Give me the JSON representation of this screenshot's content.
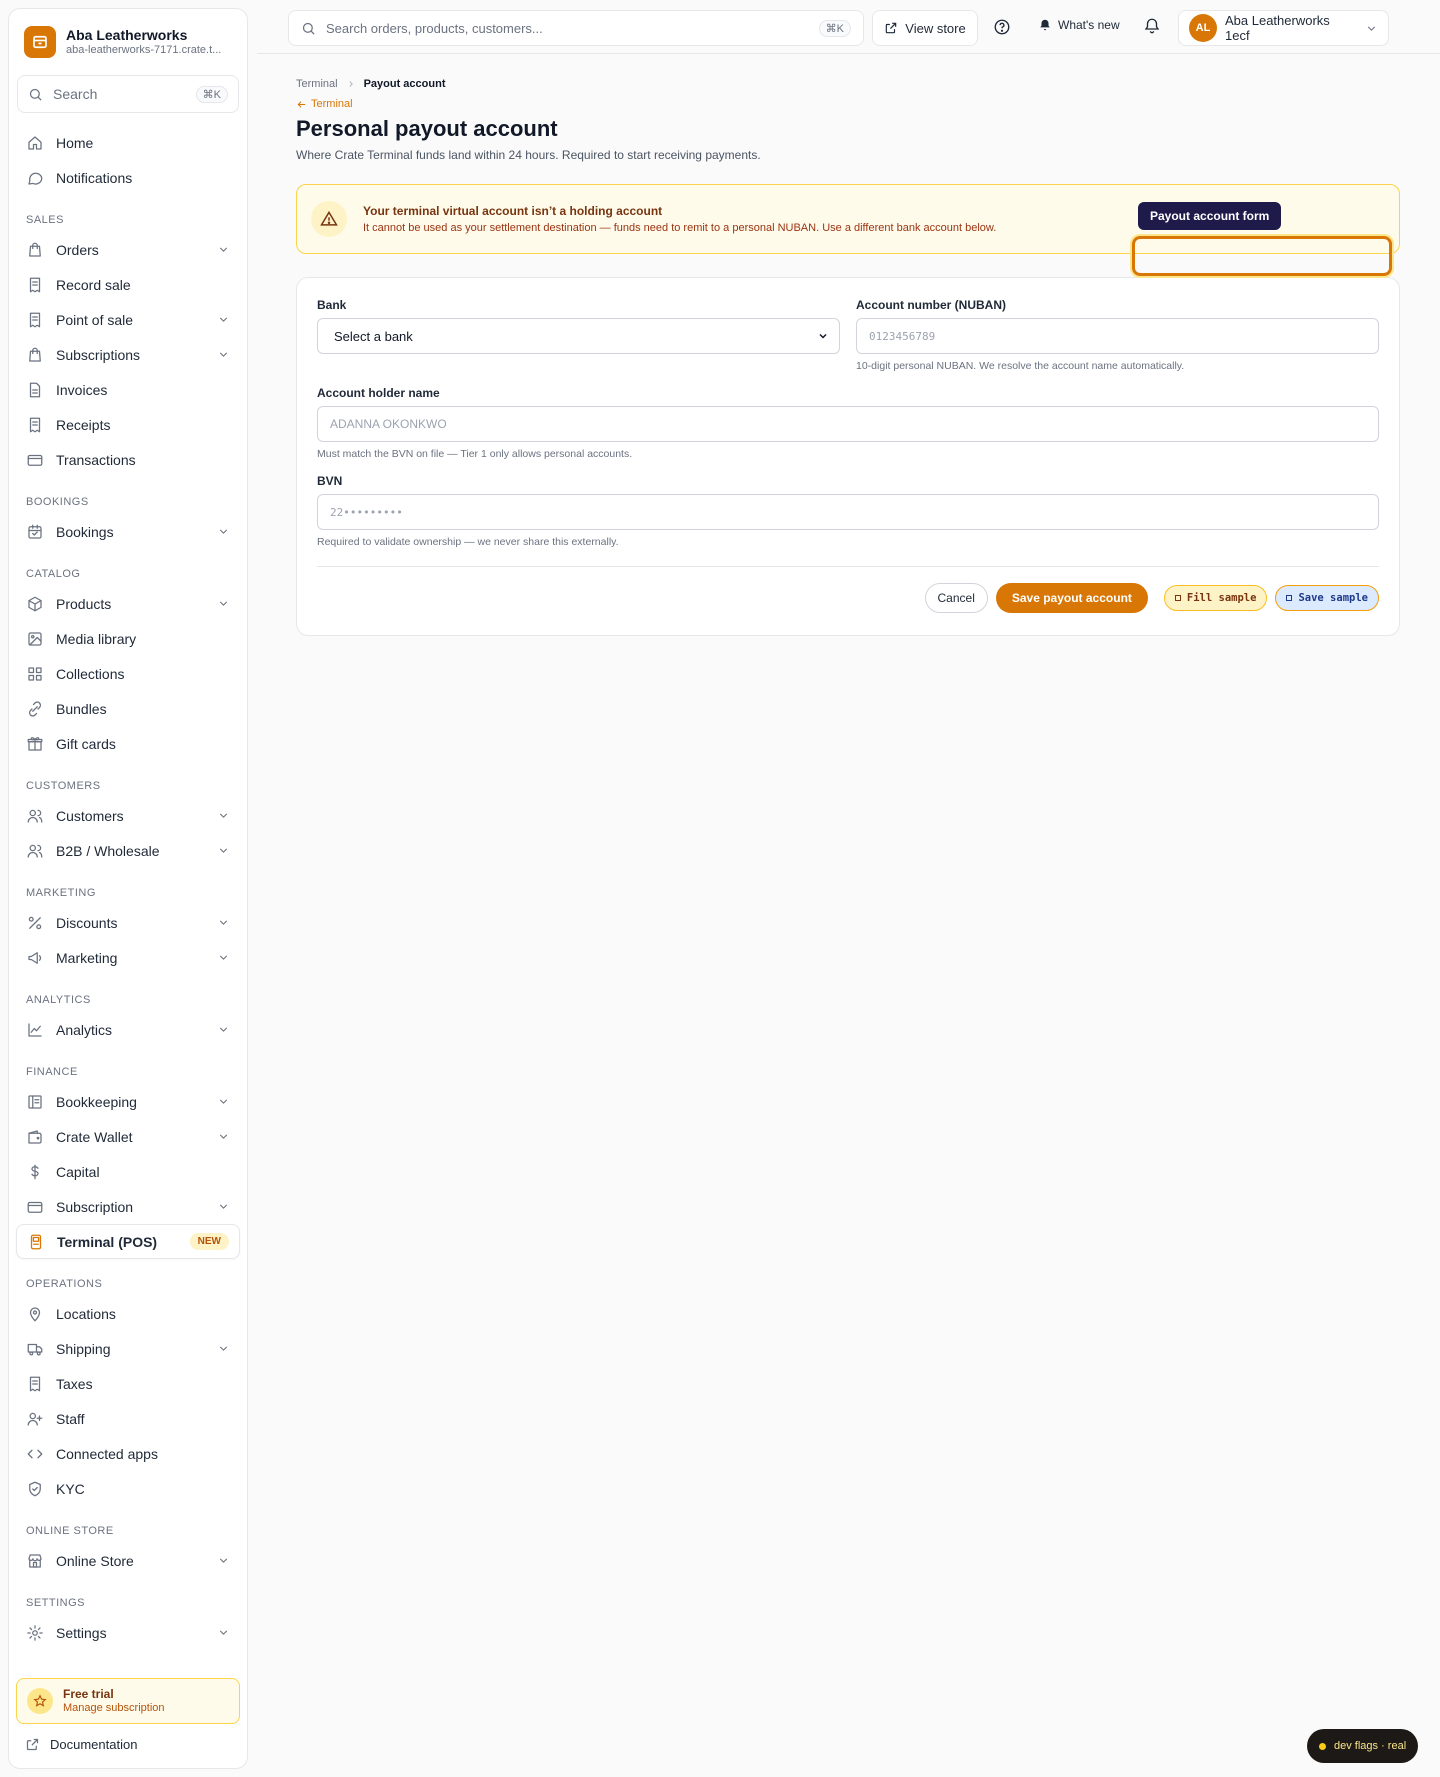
{
  "brand": {
    "name": "Aba Leatherworks",
    "url": "aba-leatherworks-7171.crate.t..."
  },
  "sidebar": {
    "search_placeholder": "Search",
    "search_kbd": "⌘K",
    "top_items": [
      {
        "label": "Home",
        "icon": "home-icon"
      },
      {
        "label": "Notifications",
        "icon": "message-circle-icon"
      }
    ],
    "sections": [
      {
        "title": "SALES",
        "items": [
          {
            "label": "Orders",
            "icon": "shopping-bag-icon",
            "chevron": true
          },
          {
            "label": "Record sale",
            "icon": "receipt-icon",
            "chevron": false
          },
          {
            "label": "Point of sale",
            "icon": "receipt-icon",
            "chevron": true
          },
          {
            "label": "Subscriptions",
            "icon": "shopping-bag-icon",
            "chevron": true
          },
          {
            "label": "Invoices",
            "icon": "file-icon",
            "chevron": false
          },
          {
            "label": "Receipts",
            "icon": "receipt-icon",
            "chevron": false
          },
          {
            "label": "Transactions",
            "icon": "credit-card-icon",
            "chevron": false
          }
        ]
      },
      {
        "title": "BOOKINGS",
        "items": [
          {
            "label": "Bookings",
            "icon": "calendar-icon",
            "chevron": true
          }
        ]
      },
      {
        "title": "CATALOG",
        "items": [
          {
            "label": "Products",
            "icon": "box-icon",
            "chevron": true
          },
          {
            "label": "Media library",
            "icon": "image-icon",
            "chevron": false
          },
          {
            "label": "Collections",
            "icon": "grid-icon",
            "chevron": false
          },
          {
            "label": "Bundles",
            "icon": "link-icon",
            "chevron": false
          },
          {
            "label": "Gift cards",
            "icon": "gift-icon",
            "chevron": false
          }
        ]
      },
      {
        "title": "CUSTOMERS",
        "items": [
          {
            "label": "Customers",
            "icon": "users-icon",
            "chevron": true
          },
          {
            "label": "B2B / Wholesale",
            "icon": "users-icon",
            "chevron": true
          }
        ]
      },
      {
        "title": "MARKETING",
        "items": [
          {
            "label": "Discounts",
            "icon": "percent-icon",
            "chevron": true
          },
          {
            "label": "Marketing",
            "icon": "megaphone-icon",
            "chevron": true
          }
        ]
      },
      {
        "title": "ANALYTICS",
        "items": [
          {
            "label": "Analytics",
            "icon": "chart-line-icon",
            "chevron": true
          }
        ]
      },
      {
        "title": "FINANCE",
        "items": [
          {
            "label": "Bookkeeping",
            "icon": "ledger-icon",
            "chevron": true
          },
          {
            "label": "Crate Wallet",
            "icon": "wallet-icon",
            "chevron": true
          },
          {
            "label": "Capital",
            "icon": "dollar-icon",
            "chevron": false
          },
          {
            "label": "Subscription",
            "icon": "credit-card-icon",
            "chevron": true
          },
          {
            "label": "Terminal (POS)",
            "icon": "terminal-device-icon",
            "chevron": false,
            "active": true,
            "badge": "NEW"
          }
        ]
      },
      {
        "title": "OPERATIONS",
        "items": [
          {
            "label": "Locations",
            "icon": "map-pin-icon",
            "chevron": false
          },
          {
            "label": "Shipping",
            "icon": "truck-icon",
            "chevron": true
          },
          {
            "label": "Taxes",
            "icon": "receipt-icon",
            "chevron": false
          },
          {
            "label": "Staff",
            "icon": "user-plus-icon",
            "chevron": false
          },
          {
            "label": "Connected apps",
            "icon": "code-icon",
            "chevron": false
          },
          {
            "label": "KYC",
            "icon": "shield-check-icon",
            "chevron": false
          }
        ]
      },
      {
        "title": "ONLINE STORE",
        "items": [
          {
            "label": "Online Store",
            "icon": "store-icon",
            "chevron": true
          }
        ]
      },
      {
        "title": "SETTINGS",
        "items": [
          {
            "label": "Settings",
            "icon": "gear-icon",
            "chevron": true
          }
        ]
      }
    ],
    "trial": {
      "title": "Free trial",
      "subtitle": "Manage subscription"
    },
    "docs_label": "Documentation"
  },
  "topbar": {
    "search_placeholder": "Search orders, products, customers...",
    "search_kbd": "⌘K",
    "view_store": "View store",
    "whats_new": "What's new",
    "account_initials": "AL",
    "account_name": "Aba Leatherworks 1ecf"
  },
  "breadcrumb": {
    "parent": "Terminal",
    "current": "Payout account"
  },
  "back_link": "Terminal",
  "page": {
    "title": "Personal payout account",
    "subtitle": "Where Crate Terminal funds land within 24 hours. Required to start receiving payments."
  },
  "alert": {
    "title": "Your terminal virtual account isn’t a holding account",
    "body": "It cannot be used as your settlement destination — funds need to remit to a personal NUBAN. Use a different bank account below."
  },
  "form": {
    "bank_label": "Bank",
    "bank_value": "Select a bank",
    "account_label": "Account number (NUBAN)",
    "account_placeholder": "0123456789",
    "account_help": "10-digit personal NUBAN. We resolve the account name automatically.",
    "holder_label": "Account holder name",
    "holder_placeholder": "ADANNA OKONKWO",
    "holder_help": "Must match the BVN on file — Tier 1 only allows personal accounts.",
    "bvn_label": "BVN",
    "bvn_placeholder": "22•••••••••",
    "bvn_help": "Required to validate ownership — we never share this externally.",
    "cancel": "Cancel",
    "save": "Save payout account",
    "fill_sample": "Fill sample",
    "save_sample": "Save sample"
  },
  "annotation": {
    "label": "Payout account form"
  },
  "dev_flags": "dev flags · real",
  "colors": {
    "accent": "#d97706",
    "warning_bg": "#fffbeb",
    "tag_bg": "#1e1b4b"
  }
}
